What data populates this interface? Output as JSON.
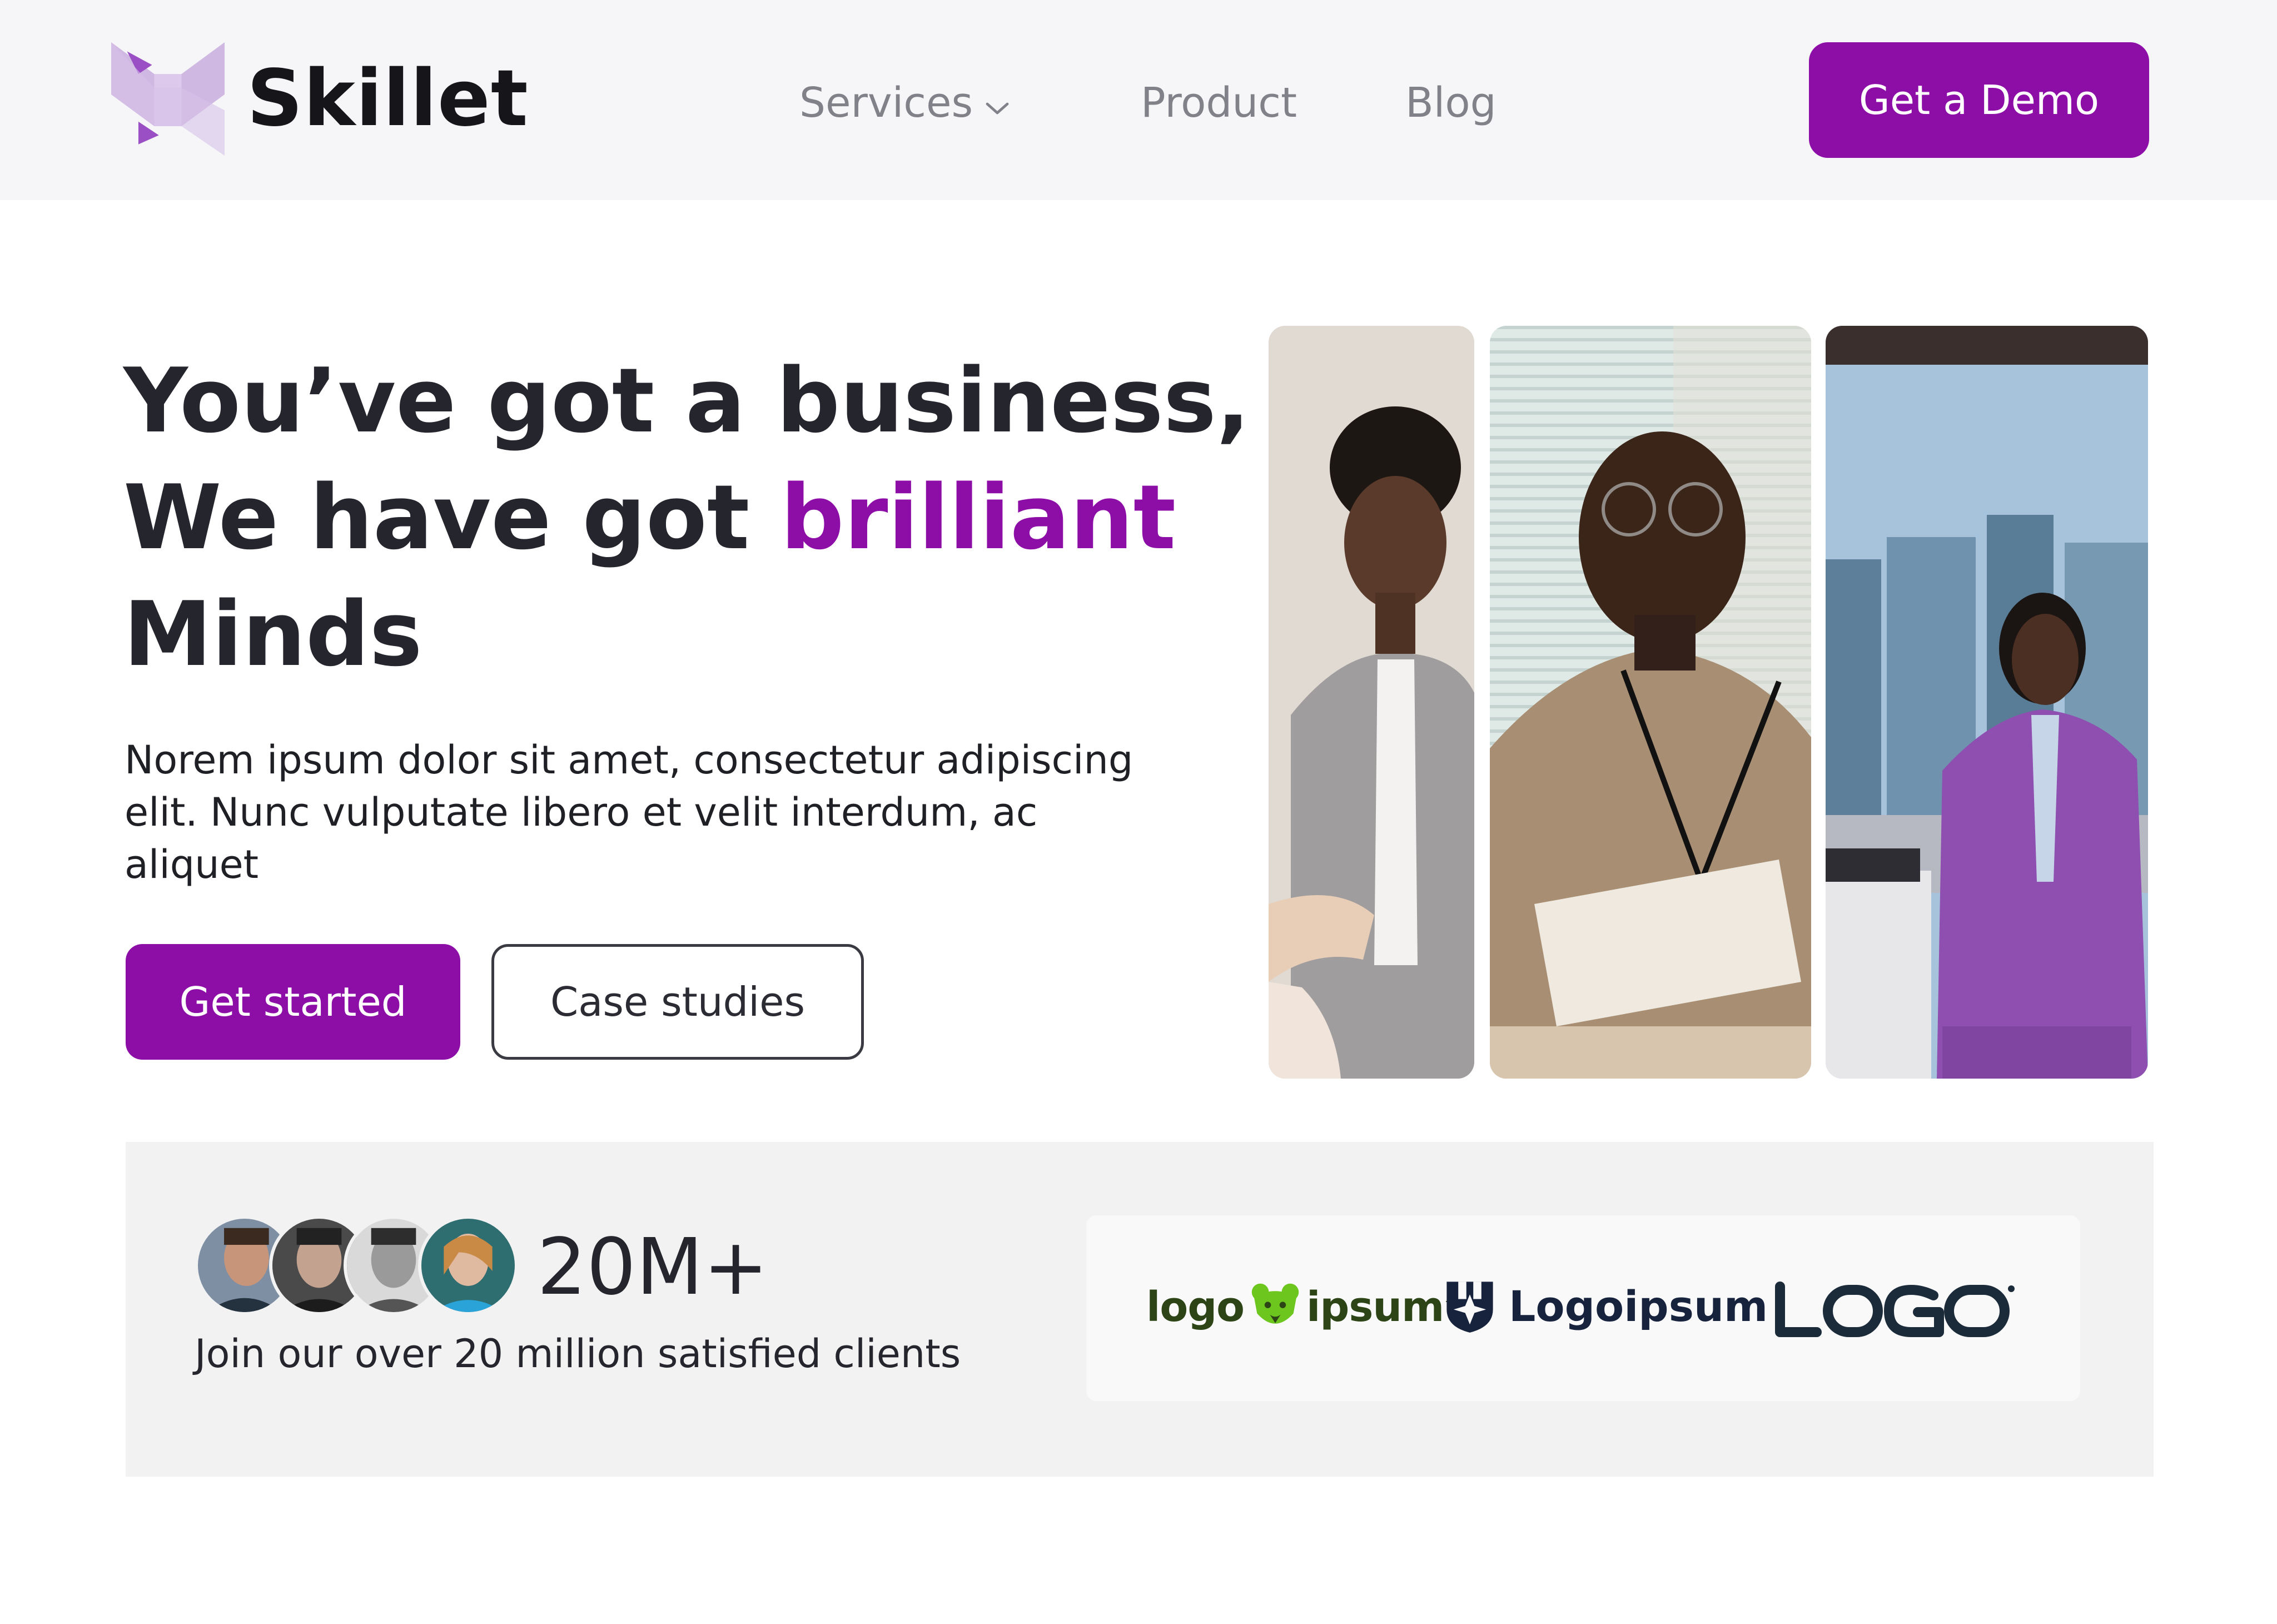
{
  "header": {
    "brand": "Skillet",
    "nav": [
      {
        "label": "Services",
        "has_dropdown": true
      },
      {
        "label": "Product"
      },
      {
        "label": "Blog"
      }
    ],
    "cta_label": "Get a Demo"
  },
  "hero": {
    "headline_line1": "You’ve got a business,",
    "headline_line2_prefix": "We have got ",
    "headline_accent": "brilliant",
    "headline_line3": "Minds",
    "subtext": "Norem ipsum dolor sit amet, consectetur adipiscing elit. Nunc vulputate libero et velit interdum, ac aliquet",
    "primary_button": "Get started",
    "secondary_button": "Case studies"
  },
  "social_proof": {
    "stat": "20M+",
    "caption": "Join our over 20 million satisfied clients",
    "partner_logos": [
      {
        "name": "logo-ipsum-bear",
        "text_left": "logo",
        "text_right": "ipsum",
        "mark": "™"
      },
      {
        "name": "logoipsum-shield",
        "text": "Logoipsum",
        "mark": "®"
      },
      {
        "name": "logo-wordmark",
        "text": "LOGO"
      }
    ]
  },
  "colors": {
    "brand": "#8d0ea7",
    "header_bg": "#f6f6f8",
    "band_bg": "#f2f2f3",
    "text_dark": "#25252d"
  },
  "icons": [
    "skillet-logo-icon",
    "chevron-down-icon",
    "bear-icon",
    "shield-icon"
  ]
}
